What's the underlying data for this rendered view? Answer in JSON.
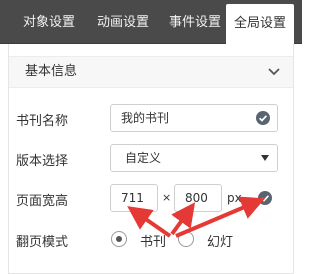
{
  "tabs": [
    {
      "label": "对象设置"
    },
    {
      "label": "动画设置"
    },
    {
      "label": "事件设置"
    },
    {
      "label": "全局设置"
    }
  ],
  "panel": {
    "title": "基本信息"
  },
  "form": {
    "book_name": {
      "label": "书刊名称",
      "value": "我的书刊"
    },
    "version": {
      "label": "版本选择",
      "selected": "自定义"
    },
    "page_size": {
      "label": "页面宽高",
      "width": "711",
      "times": "×",
      "height": "800",
      "unit": "px"
    },
    "flip_mode": {
      "label": "翻页模式",
      "options": [
        {
          "label": "书刊",
          "checked": true
        },
        {
          "label": "幻灯",
          "checked": false
        }
      ]
    }
  },
  "colors": {
    "tabbar_bg": "#4a4a4a",
    "annotation_red": "#e53935"
  },
  "icons": {
    "collapse": "chevron-down-icon",
    "confirm": "check-circle-icon",
    "dropdown": "triangle-down-icon"
  }
}
